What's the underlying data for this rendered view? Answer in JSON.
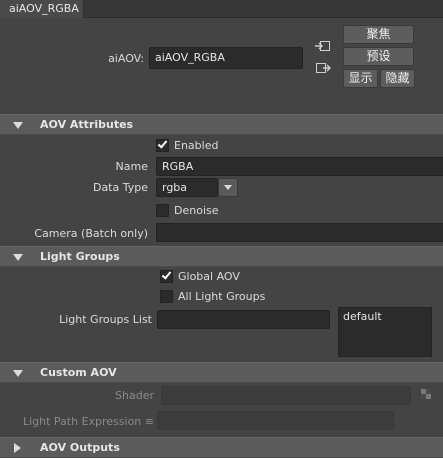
{
  "tab": {
    "label": "aiAOV_RGBA"
  },
  "node": {
    "label": "aiAOV:",
    "value": "aiAOV_RGBA"
  },
  "buttons": {
    "focus": "聚焦",
    "presets": "预设",
    "show": "显示",
    "hide": "隐藏"
  },
  "sections": {
    "aov_attributes": "AOV Attributes",
    "light_groups": "Light Groups",
    "custom_aov": "Custom AOV",
    "aov_outputs": "AOV Outputs"
  },
  "aov": {
    "enabled_label": "Enabled",
    "enabled": true,
    "name_label": "Name",
    "name_value": "RGBA",
    "data_type_label": "Data Type",
    "data_type_value": "rgba",
    "denoise_label": "Denoise",
    "denoise": false,
    "camera_label": "Camera (Batch only)",
    "camera_value": ""
  },
  "light_groups": {
    "global_aov_label": "Global AOV",
    "global_aov": true,
    "all_groups_label": "All Light Groups",
    "all_groups": false,
    "list_label": "Light Groups List",
    "list_value": "",
    "list_items": [
      "default"
    ]
  },
  "custom_aov": {
    "shader_label": "Shader",
    "lpe_label": "Light Path Expression ≡"
  }
}
